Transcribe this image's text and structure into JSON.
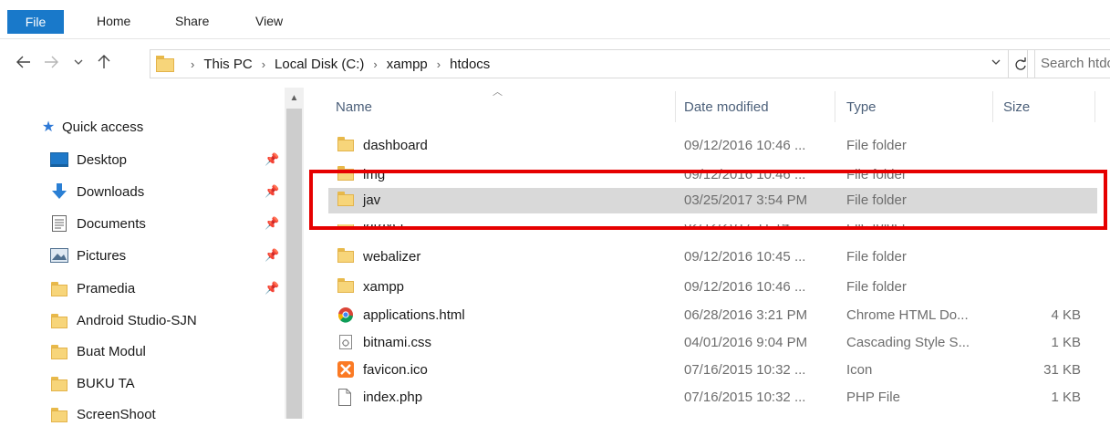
{
  "ribbon": {
    "tabs": [
      {
        "label": "File"
      },
      {
        "label": "Home"
      },
      {
        "label": "Share"
      },
      {
        "label": "View"
      }
    ]
  },
  "address": {
    "crumbs": [
      "This PC",
      "Local Disk (C:)",
      "xampp",
      "htdocs"
    ],
    "search_placeholder": "Search htdocs"
  },
  "nav": {
    "quick_access": "Quick access",
    "items": [
      {
        "label": "Desktop",
        "icon": "desktop-icon",
        "pinned": true
      },
      {
        "label": "Downloads",
        "icon": "downloads-icon",
        "pinned": true
      },
      {
        "label": "Documents",
        "icon": "documents-icon",
        "pinned": true
      },
      {
        "label": "Pictures",
        "icon": "pictures-icon",
        "pinned": true
      },
      {
        "label": "Pramedia",
        "icon": "folder-icon",
        "pinned": true
      },
      {
        "label": "Android Studio-SJN",
        "icon": "folder-icon",
        "pinned": false
      },
      {
        "label": "Buat Modul",
        "icon": "folder-icon",
        "pinned": false
      },
      {
        "label": "BUKU TA",
        "icon": "folder-icon",
        "pinned": false
      },
      {
        "label": "ScreenShoot",
        "icon": "folder-icon",
        "pinned": false
      }
    ]
  },
  "columns": {
    "name": "Name",
    "date": "Date modified",
    "type": "Type",
    "size": "Size"
  },
  "files": [
    {
      "name": "dashboard",
      "date": "09/12/2016 10:46 ...",
      "type": "File folder",
      "size": "",
      "icon": "folder-icon"
    },
    {
      "name": "img",
      "date": "09/12/2016 10:46 ...",
      "type": "File folder",
      "size": "",
      "icon": "folder-icon"
    },
    {
      "name": "jav",
      "date": "03/25/2017 3:54 PM",
      "type": "File folder",
      "size": "",
      "icon": "folder-icon",
      "selected": true
    },
    {
      "name": "laravel",
      "date": "02/12/2017 11:14 ...",
      "type": "File folder",
      "size": "",
      "icon": "folder-icon"
    },
    {
      "name": "webalizer",
      "date": "09/12/2016 10:45 ...",
      "type": "File folder",
      "size": "",
      "icon": "folder-icon"
    },
    {
      "name": "xampp",
      "date": "09/12/2016 10:46 ...",
      "type": "File folder",
      "size": "",
      "icon": "folder-icon"
    },
    {
      "name": "applications.html",
      "date": "06/28/2016 3:21 PM",
      "type": "Chrome HTML Do...",
      "size": "4 KB",
      "icon": "chrome-icon"
    },
    {
      "name": "bitnami.css",
      "date": "04/01/2016 9:04 PM",
      "type": "Cascading Style S...",
      "size": "1 KB",
      "icon": "css-file-icon"
    },
    {
      "name": "favicon.ico",
      "date": "07/16/2015 10:32 ...",
      "type": "Icon",
      "size": "31 KB",
      "icon": "xampp-icon"
    },
    {
      "name": "index.php",
      "date": "07/16/2015 10:32 ...",
      "type": "PHP File",
      "size": "1 KB",
      "icon": "file-icon"
    }
  ],
  "colors": {
    "file_tab": "#1979ca",
    "selection": "#d9d9d9",
    "highlight_box": "#e60000"
  }
}
